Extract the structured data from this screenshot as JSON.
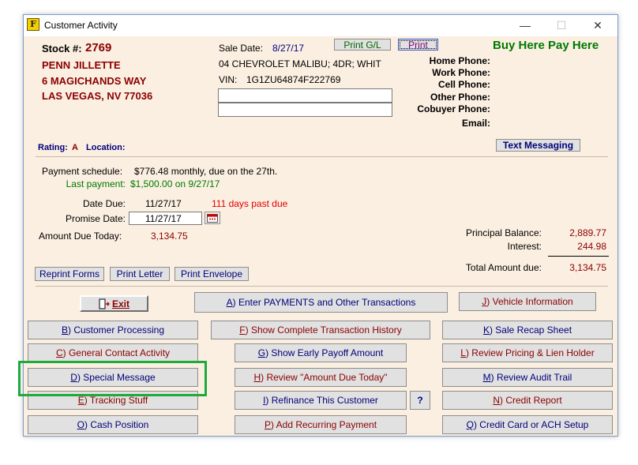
{
  "window": {
    "title": "Customer Activity",
    "minimize": "—",
    "maximize": "☐",
    "close": "✕"
  },
  "customer": {
    "stock_label": "Stock #:",
    "stock_number": "2769",
    "name": "PENN JILLETTE",
    "address": "6 MAGICHANDS WAY",
    "city_state_zip": "LAS VEGAS, NV 77036"
  },
  "vehicle": {
    "sale_date_label": "Sale Date:",
    "sale_date": "8/27/17",
    "description": "04 CHEVROLET MALIBU; 4DR; WHIT",
    "vin_label": "VIN:",
    "vin": "1G1ZU64874F222769"
  },
  "top_buttons": {
    "print_gl": "Print G/L",
    "print": "Print"
  },
  "dealer_tagline": "Buy Here Pay Here",
  "phones": {
    "home": "Home Phone:",
    "work": "Work Phone:",
    "cell": "Cell Phone:",
    "other": "Other Phone:",
    "cobuyer": "Cobuyer Phone:",
    "email": "Email:"
  },
  "rating": {
    "rating_label": "Rating:",
    "rating_value": "A",
    "location_label": "Location:"
  },
  "text_messaging": "Text Messaging",
  "payment": {
    "schedule_label": "Payment schedule:",
    "schedule_value": "$776.48 monthly, due on the 27th.",
    "last_payment_label": "Last payment:",
    "last_payment_value": "$1,500.00 on  9/27/17",
    "date_due_label": "Date Due:",
    "date_due": "11/27/17",
    "past_due": "111 days past due",
    "promise_label": "Promise Date:",
    "promise_date": "11/27/17",
    "amount_due_label": "Amount Due Today:",
    "amount_due": "3,134.75"
  },
  "balances": {
    "principal_label": "Principal Balance:",
    "principal": "2,889.77",
    "interest_label": "Interest:",
    "interest": "244.98",
    "total_label": "Total Amount due:",
    "total": "3,134.75"
  },
  "print_buttons": {
    "reprint_forms": "Reprint Forms",
    "print_letter": "Print Letter",
    "print_envelope": "Print Envelope"
  },
  "actions": {
    "exit": "Exit",
    "exit_key": "E",
    "enter_payments_key": "A",
    "enter_payments": ") Enter PAYMENTS and Other Transactions",
    "vehicle_info_key": "J",
    "vehicle_info": ") Vehicle Information",
    "customer_processing_key": "B",
    "customer_processing": ") Customer Processing",
    "transaction_history_key": "F",
    "transaction_history": ") Show Complete Transaction History",
    "sale_recap_key": "K",
    "sale_recap": ") Sale Recap Sheet",
    "general_contact_key": "C",
    "general_contact": ") General Contact Activity",
    "early_payoff_key": "G",
    "early_payoff": ") Show Early Payoff Amount",
    "review_pricing_key": "L",
    "review_pricing": ") Review Pricing & Lien Holder",
    "special_message_key": "D",
    "special_message": ") Special Message",
    "review_amount_due_key": "H",
    "review_amount_due": ") Review \"Amount Due Today\"",
    "audit_trail_key": "M",
    "audit_trail": ") Review Audit Trail",
    "tracking_key": "E",
    "tracking": ") Tracking Stuff",
    "refinance_key": "I",
    "refinance": ") Refinance This Customer",
    "help": "?",
    "credit_report_key": "N",
    "credit_report": ") Credit Report",
    "cash_position_key": "O",
    "cash_position": ") Cash Position",
    "recurring_payment_key": "P",
    "recurring_payment": ") Add Recurring Payment",
    "credit_card_key": "Q",
    "credit_card": ") Credit Card or ACH Setup"
  },
  "colors": {
    "highlight": "#1faa3c",
    "client_bg": "#fbefe1",
    "navy": "#00007a",
    "maroon": "#8b0000"
  }
}
